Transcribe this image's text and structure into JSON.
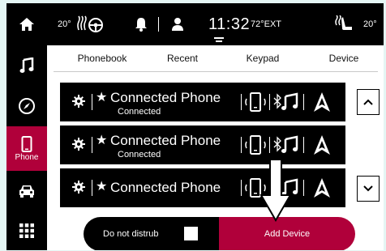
{
  "status": {
    "left_temp": "20°",
    "clock": "11:32",
    "outside_temp": "72°EXT",
    "right_temp": "20°"
  },
  "sidebar": {
    "items": [
      {
        "icon": "home-icon",
        "label": ""
      },
      {
        "icon": "music-icon",
        "label": ""
      },
      {
        "icon": "compass-icon",
        "label": ""
      },
      {
        "icon": "phone-icon",
        "label": "Phone",
        "active": true
      },
      {
        "icon": "car-icon",
        "label": ""
      },
      {
        "icon": "apps-grid-icon",
        "label": ""
      }
    ]
  },
  "tabs": [
    "Phonebook",
    "Recent",
    "Keypad",
    "Device"
  ],
  "devices": [
    {
      "name": "Connected Phone",
      "status": "Connected",
      "favorite": "★"
    },
    {
      "name": "Connected Phone",
      "status": "Connected",
      "favorite": "★"
    },
    {
      "name": "Connected Phone",
      "status": "",
      "favorite": "★"
    }
  ],
  "bottom": {
    "dnd_label": "Do not distrub",
    "add_device_label": "Add Device"
  },
  "colors": {
    "accent": "#b0003a",
    "background": "#e5f6f4"
  }
}
